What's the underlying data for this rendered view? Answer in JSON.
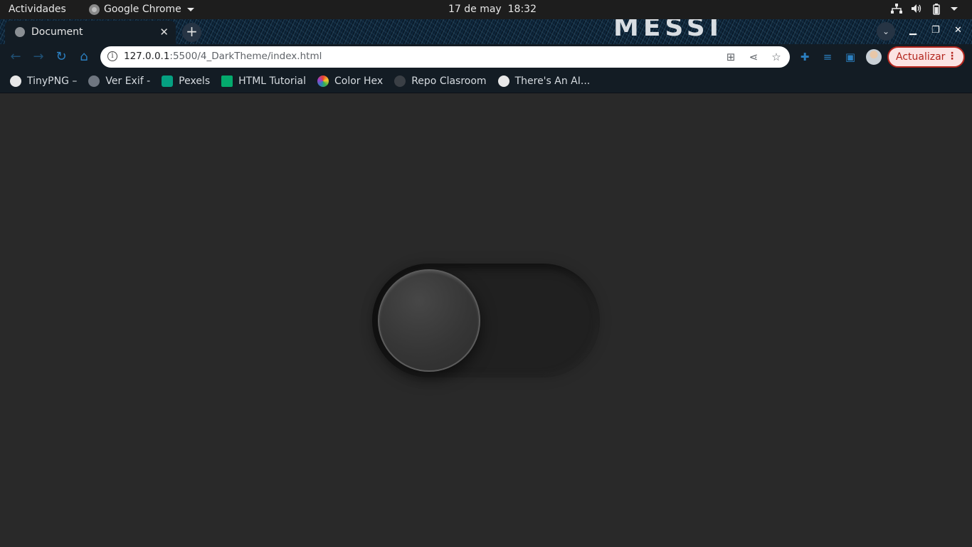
{
  "system_bar": {
    "activities": "Actividades",
    "app_name": "Google Chrome",
    "date": "17 de may",
    "time": "18:32"
  },
  "tabs": [
    {
      "title": "Document",
      "active": true
    }
  ],
  "tab_strip": {
    "theme_brand_text": "MESSI"
  },
  "toolbar": {
    "url_host": "127.0.0.1",
    "url_rest": ":5500/4_DarkTheme/index.html",
    "update_label": "Actualizar"
  },
  "bookmarks": [
    {
      "label": "TinyPNG –",
      "icon": "panda-icon",
      "color": "#e8e8e8"
    },
    {
      "label": "Ver Exif -",
      "icon": "globe-icon",
      "color": "#6f7680"
    },
    {
      "label": "Pexels",
      "icon": "pexels-icon",
      "color": "#05a081"
    },
    {
      "label": "HTML Tutorial",
      "icon": "w3schools-icon",
      "color": "#04aa6d"
    },
    {
      "label": "Color Hex",
      "icon": "color-wheel-icon",
      "color": "#e9412f"
    },
    {
      "label": "Repo Clasroom",
      "icon": "github-icon",
      "color": "#3a3f45"
    },
    {
      "label": "There's An AI...",
      "icon": "arm-icon",
      "color": "#e8e8e8"
    }
  ],
  "toggle": {
    "state": "off"
  },
  "colors": {
    "page_background": "#292929",
    "chrome_frame": "#131c24",
    "accent": "#2b7fc0",
    "update_button": "#b3261e"
  }
}
